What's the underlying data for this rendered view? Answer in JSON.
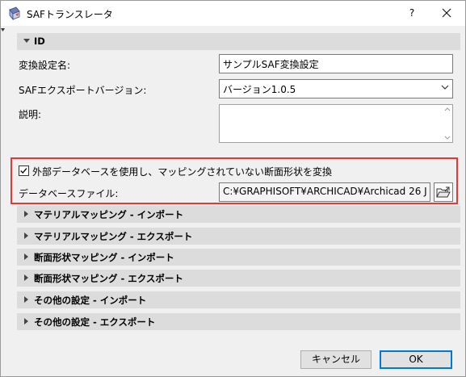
{
  "window": {
    "title": "SAFトランスレータ",
    "help_label": "?"
  },
  "id_section": {
    "header": "ID",
    "name_label": "変換設定名:",
    "name_value": "サンプルSAF変換設定",
    "version_label": "SAFエクスポートバージョン:",
    "version_value": "バージョン1.0.5",
    "description_label": "説明:",
    "description_value": ""
  },
  "external_db": {
    "checkbox_label": "外部データベースを使用し、マッピングされていない断面形状を変換",
    "checked": true,
    "file_label": "データベースファイル:",
    "file_value": "C:¥GRAPHISOFT¥ARCHICAD¥Archicad 26 J"
  },
  "sections": [
    {
      "label": "マテリアルマッピング - インポート"
    },
    {
      "label": "マテリアルマッピング - エクスポート"
    },
    {
      "label": "断面形状マッピング - インポート"
    },
    {
      "label": "断面形状マッピング - エクスポート"
    },
    {
      "label": "その他の設定 - インポート"
    },
    {
      "label": "その他の設定 - エクスポート"
    }
  ],
  "footer": {
    "cancel_label": "キャンセル",
    "ok_label": "OK"
  },
  "colors": {
    "highlight": "#e53935",
    "default_button_border": "#0078d7",
    "section_header_bg": "#dcdcdc"
  }
}
